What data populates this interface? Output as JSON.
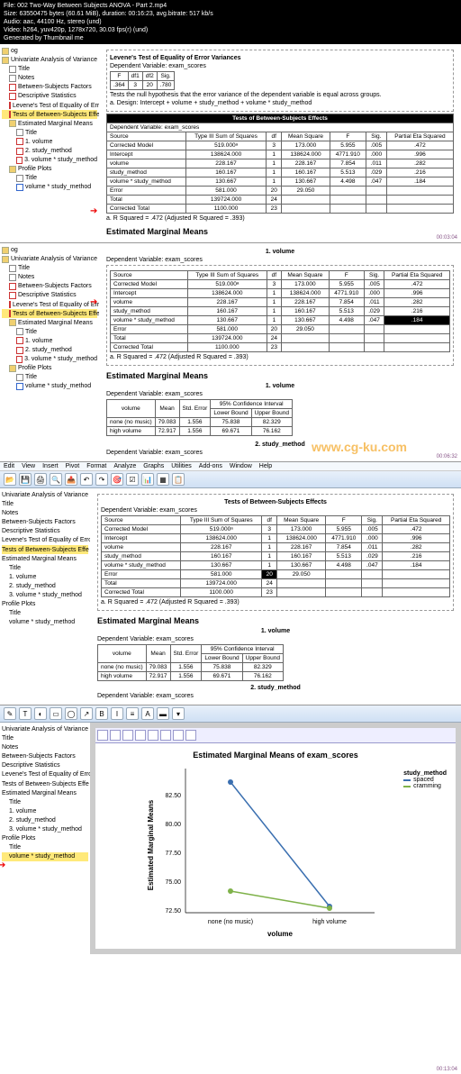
{
  "meta": {
    "l1": "File: 002 Two-Way Between Subjects ANOVA - Part 2.mp4",
    "l2": "Size: 63550475 bytes (60.61 MiB), duration: 00:16:23, avg.bitrate: 517 kb/s",
    "l3": "Audio: aac, 44100 Hz, stereo (und)",
    "l4": "Video: h264, yuv420p, 1278x720, 30.03 fps(r) (und)",
    "l5": "Generated by Thumbnail me"
  },
  "tree": {
    "log": "og",
    "root": "Univariate Analysis of Variance",
    "title": "Title",
    "notes": "Notes",
    "bsf": "Between-Subjects Factors",
    "desc": "Descriptive Statistics",
    "levene": "Levene's Test of Equality of Erro",
    "tests": "Tests of Between-Subjects Effe",
    "emm": "Estimated Marginal Means",
    "v1": "1. volume",
    "v2": "2. study_method",
    "v3": "3. volume * study_method",
    "profile": "Profile Plots",
    "vsm": "volume * study_method"
  },
  "levene": {
    "title": "Levene's Test of Equality of Error Variances",
    "dv": "Dependent Variable:   exam_scores",
    "h": [
      "F",
      "df1",
      "df2",
      "Sig."
    ],
    "r": [
      ".364",
      "3",
      "20",
      ".780"
    ],
    "note1": "Tests the null hypothesis that the error variance of the dependent variable is equal across groups.",
    "note2": "a. Design: Intercept + volume + study_method + volume * study_method"
  },
  "between": {
    "title": "Tests of Between-Subjects Effects",
    "dv": "Dependent Variable: exam_scores",
    "h": [
      "Source",
      "Type III Sum of Squares",
      "df",
      "Mean Square",
      "F",
      "Sig.",
      "Partial Eta Squared"
    ],
    "rows": [
      [
        "Corrected Model",
        "519.000ᵃ",
        "3",
        "173.000",
        "5.955",
        ".005",
        ".472"
      ],
      [
        "Intercept",
        "138624.000",
        "1",
        "138624.000",
        "4771.910",
        ".000",
        ".996"
      ],
      [
        "volume",
        "228.167",
        "1",
        "228.167",
        "7.854",
        ".011",
        ".282"
      ],
      [
        "study_method",
        "160.167",
        "1",
        "160.167",
        "5.513",
        ".029",
        ".216"
      ],
      [
        "volume * study_method",
        "130.667",
        "1",
        "130.667",
        "4.498",
        ".047",
        ".184"
      ],
      [
        "Error",
        "581.000",
        "20",
        "29.050",
        "",
        "",
        ""
      ],
      [
        "Total",
        "139724.000",
        "24",
        "",
        "",
        "",
        ""
      ],
      [
        "Corrected Total",
        "1100.000",
        "23",
        "",
        "",
        "",
        ""
      ]
    ],
    "foot": "a. R Squared = .472 (Adjusted R Squared = .393)"
  },
  "emm_title": "Estimated Marginal Means",
  "emm1": {
    "title": "1. volume",
    "dv": "Dependent Variable:   exam_scores",
    "h1": [
      "volume",
      "Mean",
      "Std. Error",
      "95% Confidence Interval"
    ],
    "h2": [
      "Lower Bound",
      "Upper Bound"
    ],
    "rows": [
      [
        "none (no music)",
        "79.083",
        "1.556",
        "75.838",
        "82.329"
      ],
      [
        "high volume",
        "72.917",
        "1.556",
        "69.671",
        "76.162"
      ]
    ]
  },
  "emm2": {
    "title": "2. study_method",
    "dv": "Dependent Variable:   exam_scores"
  },
  "watermark": "www.cg-ku.com",
  "menu": [
    "Edit",
    "View",
    "Insert",
    "Pivot",
    "Format",
    "Analyze",
    "Graphs",
    "Utilities",
    "Add-ons",
    "Window",
    "Help"
  ],
  "chart": {
    "title": "Estimated Marginal Means of exam_scores",
    "ylabel": "Estimated Marginal Means",
    "xlabel": "volume",
    "xcats": [
      "none (no music)",
      "high volume"
    ],
    "yticks": [
      "72.50",
      "75.00",
      "77.50",
      "80.00",
      "82.50"
    ],
    "legend_title": "study_method",
    "legend": [
      "spaced",
      "cramming"
    ]
  },
  "chart_data": {
    "type": "line",
    "title": "Estimated Marginal Means of exam_scores",
    "xlabel": "volume",
    "ylabel": "Estimated Marginal Means",
    "categories": [
      "none (no music)",
      "high volume"
    ],
    "series": [
      {
        "name": "spaced",
        "values": [
          83.83,
          73.0
        ],
        "color": "#3a6fb0"
      },
      {
        "name": "cramming",
        "values": [
          74.33,
          72.83
        ],
        "color": "#7fb24a"
      }
    ],
    "ylim": [
      72.5,
      85.0
    ]
  },
  "timestamps": {
    "t1": "00:03:04",
    "t2": "00:06:32",
    "t3": "00:13:04"
  }
}
